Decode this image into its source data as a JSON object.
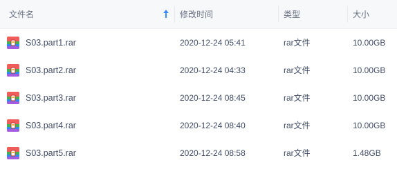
{
  "columns": {
    "name": "文件名",
    "modified": "修改时间",
    "type": "类型",
    "size": "大小"
  },
  "sort": {
    "column": "name",
    "direction": "ascending",
    "icon": "arrow-up-icon",
    "color": "#3b8cff"
  },
  "file_icon": {
    "name": "rar-archive-icon",
    "colors": [
      "#f05b5b",
      "#3fb34f",
      "#2d8cf0",
      "#f7b21a",
      "#a35ce0"
    ]
  },
  "files": [
    {
      "name": "S03.part1.rar",
      "modified": "2020-12-24 05:41",
      "type": "rar文件",
      "size": "10.00GB"
    },
    {
      "name": "S03.part2.rar",
      "modified": "2020-12-24 04:33",
      "type": "rar文件",
      "size": "10.00GB"
    },
    {
      "name": "S03.part3.rar",
      "modified": "2020-12-24 08:45",
      "type": "rar文件",
      "size": "10.00GB"
    },
    {
      "name": "S03.part4.rar",
      "modified": "2020-12-24 08:40",
      "type": "rar文件",
      "size": "10.00GB"
    },
    {
      "name": "S03.part5.rar",
      "modified": "2020-12-24 08:58",
      "type": "rar文件",
      "size": "1.48GB"
    }
  ]
}
